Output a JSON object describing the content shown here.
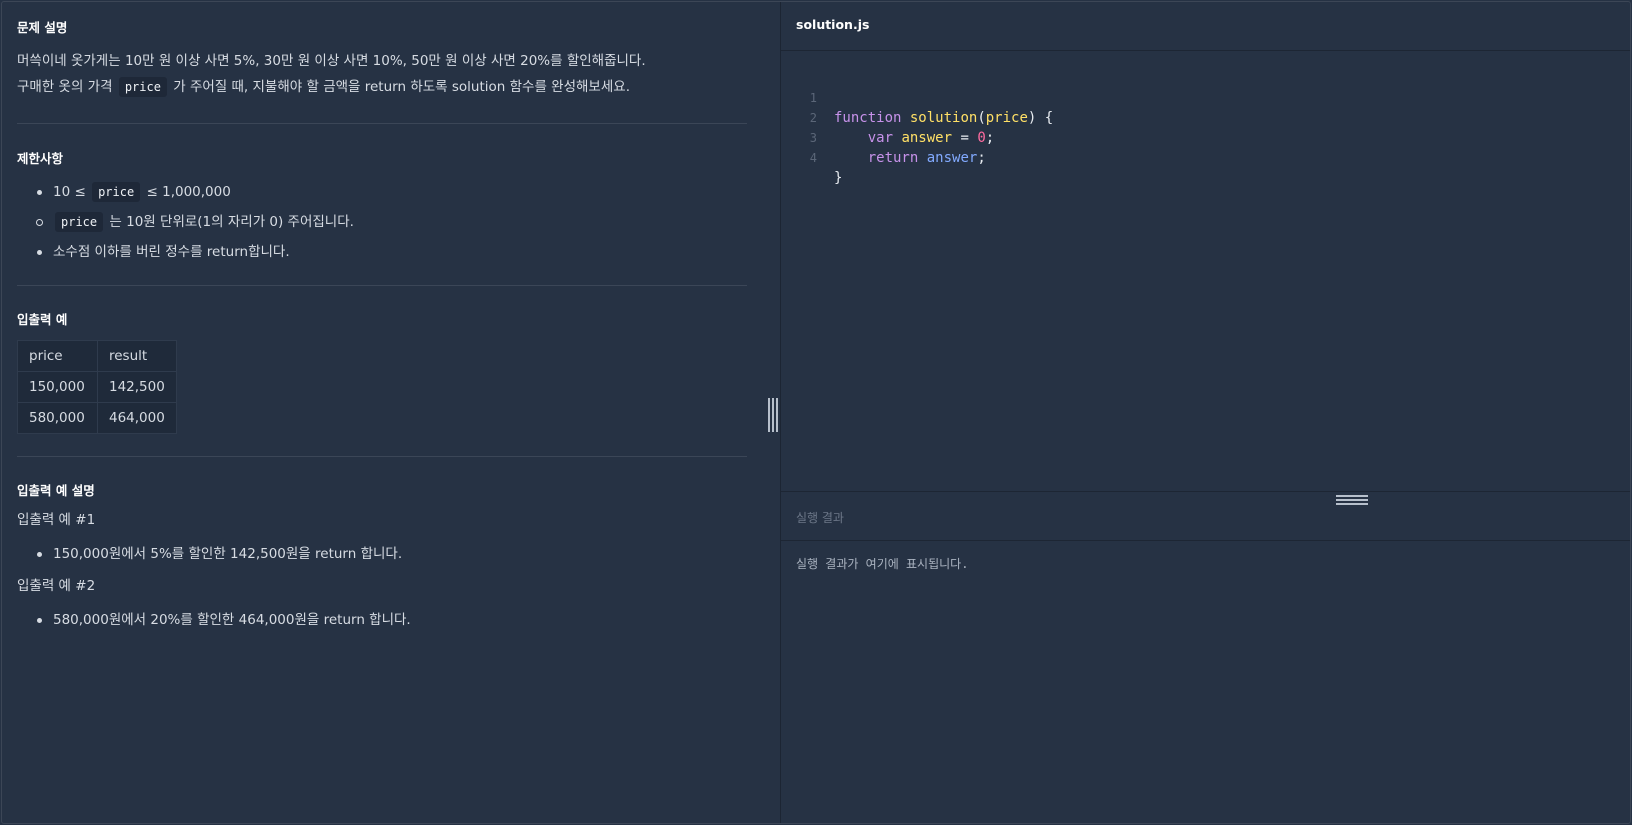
{
  "problem": {
    "title": "문제 설명",
    "line1": "머쓱이네 옷가게는 10만 원 이상 사면 5%, 30만 원 이상 사면 10%, 50만 원 이상 사면 20%를 할인해줍니다.",
    "line2_before": "구매한 옷의 가격",
    "line2_code": "price",
    "line2_after": "가 주어질 때, 지불해야 할 금액을 return 하도록 solution 함수를 완성해보세요."
  },
  "constraints": {
    "title": "제한사항",
    "item1_before": "10 ≤",
    "item1_code": "price",
    "item1_after": "≤ 1,000,000",
    "sub1_code": "price",
    "sub1_after": "는 10원 단위로(1의 자리가 0) 주어집니다.",
    "item2": "소수점 이하를 버린 정수를 return합니다."
  },
  "examples": {
    "title": "입출력 예",
    "headers": [
      "price",
      "result"
    ],
    "rows": [
      [
        "150,000",
        "142,500"
      ],
      [
        "580,000",
        "464,000"
      ]
    ]
  },
  "explanation": {
    "title": "입출력 예 설명",
    "ex1_title": "입출력 예 #1",
    "ex1_item": "150,000원에서 5%를 할인한 142,500원을 return 합니다.",
    "ex2_title": "입출력 예 #2",
    "ex2_item": "580,000원에서 20%를 할인한 464,000원을 return 합니다."
  },
  "editor": {
    "file_name": "solution.js",
    "line_numbers": [
      "1",
      "2",
      "3",
      "4"
    ],
    "tokens": {
      "l1_kw": "function",
      "l1_fn": "solution",
      "l1_open": "(",
      "l1_param": "price",
      "l1_close": ") {",
      "l2_kw": "var",
      "l2_var": "answer",
      "l2_eq": " = ",
      "l2_num": "0",
      "l2_semi": ";",
      "l3_kw": "return",
      "l3_id": "answer",
      "l3_semi": ";",
      "l4": "}"
    }
  },
  "result": {
    "title": "실행 결과",
    "placeholder": "실행 결과가 여기에 표시됩니다."
  }
}
